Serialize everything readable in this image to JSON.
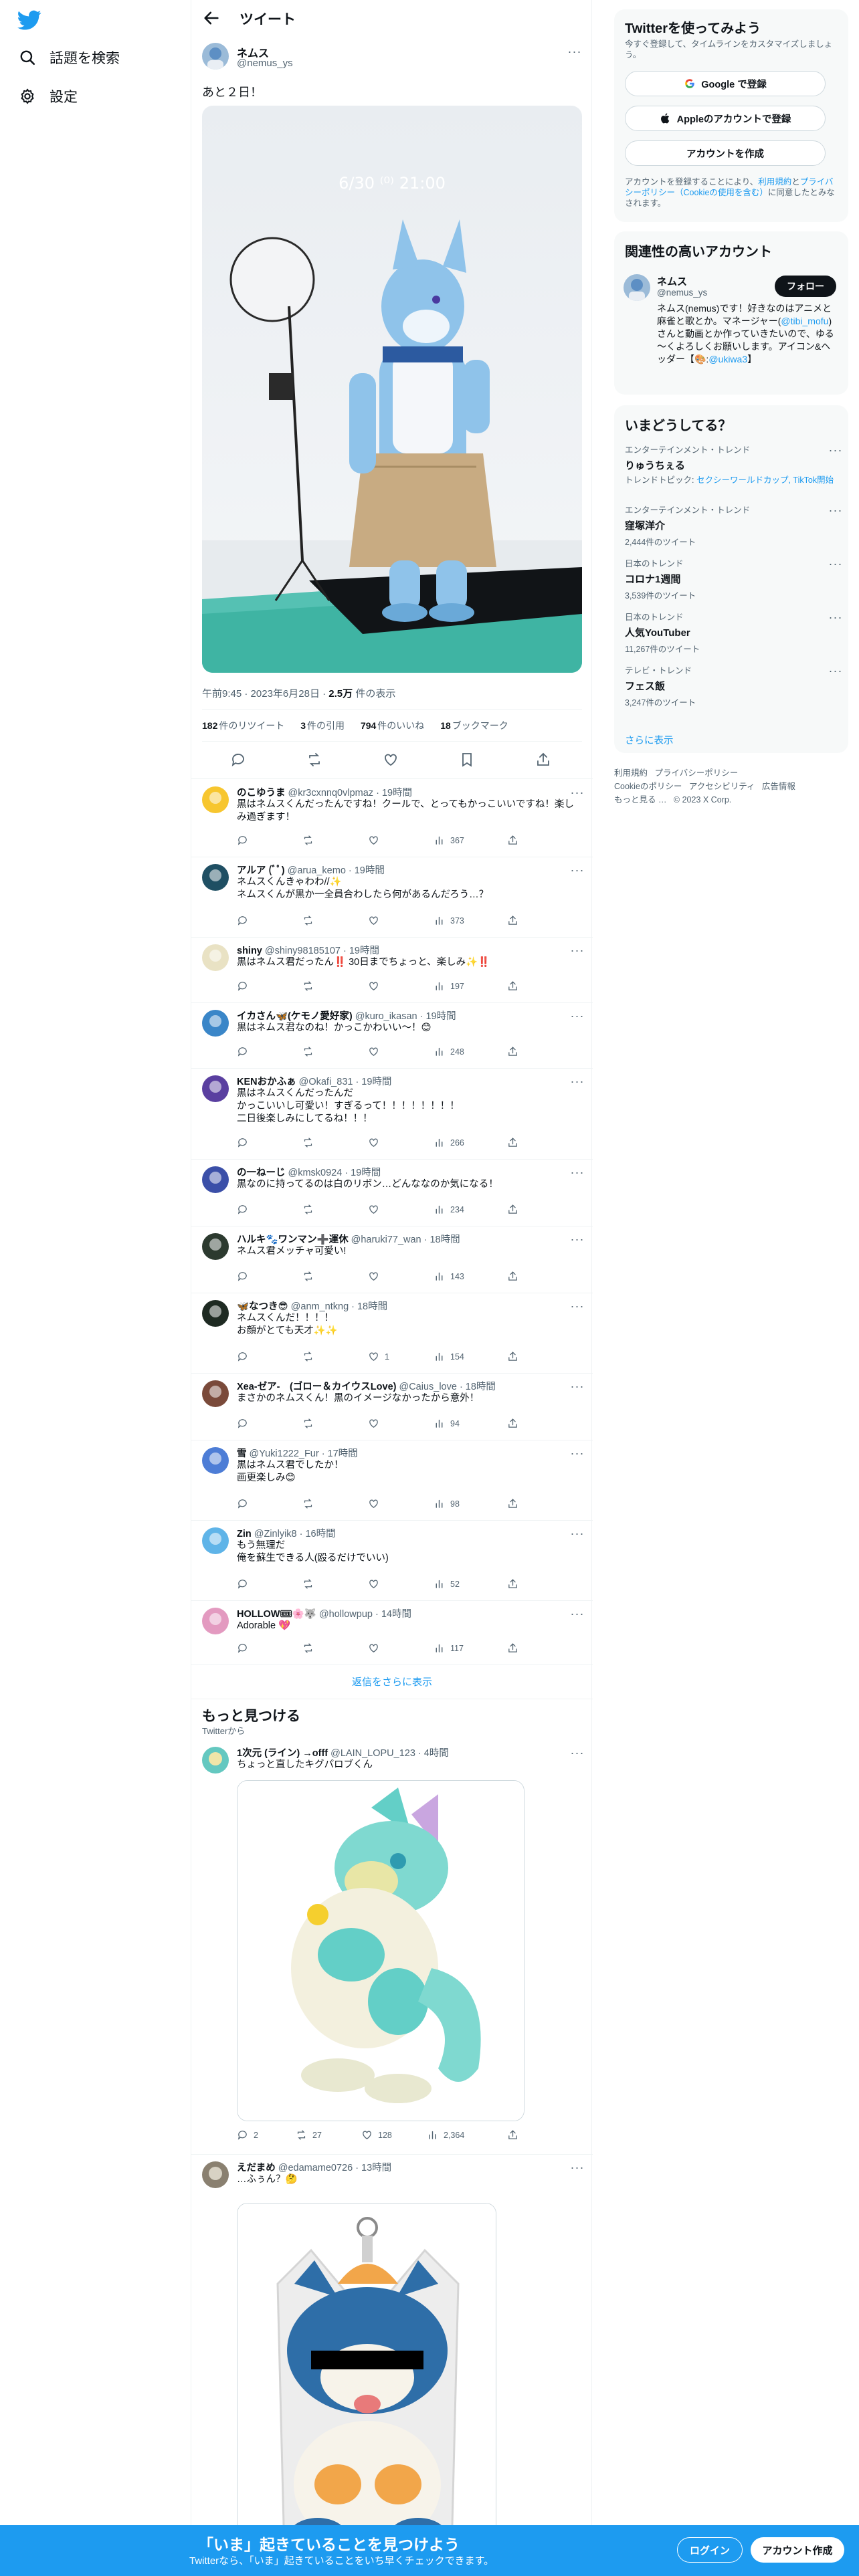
{
  "nav": {
    "explore_label": "話題を検索",
    "settings_label": "設定"
  },
  "header": {
    "title": "ツイート"
  },
  "tweet": {
    "author_name": "ネムス",
    "author_handle": "@nemus_ys",
    "text": "あと２日！",
    "photo_overlay_text": "6/30 ⁽⁰⁾ 21:00",
    "time": "午前9:45",
    "date": "2023年6月28日",
    "views": "2.5万",
    "views_label": "件の表示",
    "retweets": "182",
    "retweets_label": "件のリツイート",
    "quotes": "3",
    "quotes_label": "件の引用",
    "likes": "794",
    "likes_label": "件のいいね",
    "bookmarks": "18",
    "bookmarks_label": "ブックマーク"
  },
  "replies": [
    {
      "name": "のこゆうま",
      "handle": "@kr3cxnnq0vlpmaz",
      "time": "19時間",
      "text": "黒はネムスくんだったんですね！クールで、とってもかっこいいですね！楽しみ過ぎます！",
      "retweets": "",
      "likes": "",
      "views": "367",
      "avatar_color": "#f7c62f"
    },
    {
      "name": "アルア (ﾞﾟ)",
      "handle": "@arua_kemo",
      "time": "19時間",
      "text": "ネムスくんきゃわわ//✨\nネムスくんが黒か一全員合わしたら何があるんだろう…？",
      "retweets": "",
      "likes": "",
      "views": "373",
      "avatar_color": "#1f4f63"
    },
    {
      "name": "shiny",
      "handle": "@shiny98185107",
      "time": "19時間",
      "text": "黒はネムス君だったん‼️ 30日までちょっと、楽しみ✨‼️",
      "retweets": "",
      "likes": "",
      "views": "197",
      "avatar_color": "#e9e2c4"
    },
    {
      "name": "イカさん🦋(ケモノ愛好家)",
      "handle": "@kuro_ikasan",
      "time": "19時間",
      "text": "黒はネムス君なのね！かっこかわいい～！😊",
      "retweets": "",
      "likes": "",
      "views": "248",
      "avatar_color": "#3a86c8"
    },
    {
      "name": "KENおかふぁ",
      "handle": "@Okafi_831",
      "time": "19時間",
      "text": "黒はネムスくんだったんだ\nかっこいいし可愛い！すぎるって！！！！！！！！\n二日後楽しみにしてるね！！！",
      "retweets": "",
      "likes": "",
      "views": "266",
      "avatar_color": "#5a3fa0"
    },
    {
      "name": "の一ねーじ",
      "handle": "@kmsk0924",
      "time": "19時間",
      "text": "黒なのに持ってるのは白のリボン…どんななのか気になる！",
      "retweets": "",
      "likes": "",
      "views": "234",
      "avatar_color": "#3b4fa8"
    },
    {
      "name": "ハルキ🐾ワンマン➕運休",
      "handle": "@haruki77_wan",
      "time": "18時間",
      "text": "ネムス君メッチャ可愛い!",
      "retweets": "",
      "likes": "",
      "views": "143",
      "avatar_color": "#2c3a2f"
    },
    {
      "name": "🦋なつき😎",
      "handle": "@anm_ntkng",
      "time": "18時間",
      "text": "ネムスくんだ！！！！\nお顔がとても天才✨✨",
      "retweets": "",
      "likes": "1",
      "views": "154",
      "avatar_color": "#1e2a22"
    },
    {
      "name": "Xea-ゼア-　(ゴロー＆カイウスLove)",
      "handle": "@Caius_love",
      "time": "18時間",
      "text": "まさかのネムスくん！黒のイメージなかったから意外！",
      "retweets": "",
      "likes": "",
      "views": "94",
      "avatar_color": "#7a4a3a"
    },
    {
      "name": "雪",
      "handle": "@Yuki1222_Fur",
      "time": "17時間",
      "text": "黒はネムス君でしたか！\n画更楽しみ😊",
      "retweets": "",
      "likes": "",
      "views": "98",
      "avatar_color": "#4d7dd6"
    },
    {
      "name": "Zin",
      "handle": "@Zinlyik8",
      "time": "16時間",
      "text": "もう無理だ\n俺を蘇生できる人(殴るだけでいい)",
      "retweets": "",
      "likes": "",
      "views": "52",
      "avatar_color": "#5fb4e8"
    },
    {
      "name": "HOLLOW🎟🌸🐺",
      "handle": "@hollowpup",
      "time": "14時間",
      "text": "Adorable 💖",
      "retweets": "",
      "likes": "",
      "views": "117",
      "avatar_color": "#e39ac0"
    }
  ],
  "show_more_replies": "返信をさらに表示",
  "discover": {
    "title": "もっと見つける",
    "subtitle": "Twitterから",
    "posts": [
      {
        "name": "1次元 (ライン) →offf",
        "handle": "@LAIN_LOPU_123",
        "time": "4時間",
        "text": "ちょっと直したキグパロブくん",
        "replies": "2",
        "retweets": "27",
        "likes": "128",
        "views": "2,364",
        "avatar_color": "#64c8c0"
      },
      {
        "name": "えだまめ",
        "handle": "@edamame0726",
        "time": "13時間",
        "text": "…ふぅん？🤔",
        "avatar_color": "#8a8070"
      }
    ]
  },
  "right": {
    "signup": {
      "title": "Twitterを使ってみよう",
      "subtitle": "今すぐ登録して、タイムラインをカスタマイズしましょう。",
      "google": "Google で登録",
      "apple": "Appleのアカウントで登録",
      "create": "アカウントを作成",
      "legal_1": "アカウントを登録することにより、",
      "legal_link1": "利用規約",
      "legal_2": "と",
      "legal_link2": "プライバシーポリシー（Cookieの使用を含む）",
      "legal_3": "に同意したとみなされます。"
    },
    "related": {
      "title": "関連性の高いアカウント",
      "name": "ネムス",
      "handle": "@nemus_ys",
      "follow": "フォロー",
      "bio_1": "ネムス(nemus)です！好きなのはアニメと麻雀と歌とか。マネージャー(",
      "bio_link1": "@tibi_mofu",
      "bio_2": ")さんと動画とか作っていきたいので、ゆる～くよろしくお願いします。アイコン&ヘッダー【🎨:",
      "bio_link2": "@ukiwa3",
      "bio_3": "】"
    },
    "trends": {
      "title": "いまどうしてる？",
      "items": [
        {
          "category": "エンターテインメント・トレンド",
          "name": "りゅうちぇる",
          "promo": "トレンドトピック: ",
          "promo_links": "セクシーワールドカップ, TikTok",
          "promo_tail": "開始",
          "count": ""
        },
        {
          "category": "エンターテインメント・トレンド",
          "name": "窪塚洋介",
          "count": "2,444件のツイート"
        },
        {
          "category": "日本のトレンド",
          "name": "コロナ1週間",
          "count": "3,539件のツイート"
        },
        {
          "category": "日本のトレンド",
          "name": "人気YouTuber",
          "count": "11,267件のツイート"
        },
        {
          "category": "テレビ・トレンド",
          "name": "フェス飯",
          "count": "3,247件のツイート"
        }
      ],
      "show_more": "さらに表示"
    },
    "footer": {
      "l1": "利用規約",
      "l2": "プライバシーポリシー",
      "l3": "Cookieのポリシー",
      "l4": "アクセシビリティ",
      "l5": "広告情報",
      "l6": "もっと見る …",
      "copyright": "© 2023 X Corp."
    }
  },
  "banner": {
    "title": "「いま」起きていることを見つけよう",
    "subtitle": "Twitterなら、「いま」起きていることをいち早くチェックできます。",
    "login": "ログイン",
    "signup": "アカウント作成"
  },
  "colors": {
    "accent": "#1d9bf0",
    "text": "#0f1419",
    "secondary": "#536471",
    "border": "#eff3f4"
  }
}
